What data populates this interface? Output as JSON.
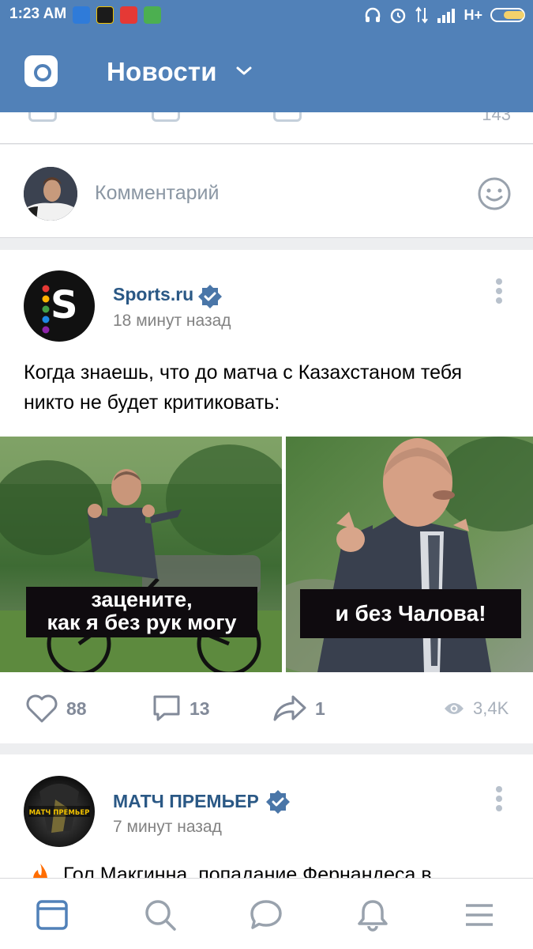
{
  "status_bar": {
    "time": "1:23 AM",
    "network": "H+",
    "colors": {
      "notif1": "#2f7bd9",
      "notif2": "#1b1b1b",
      "notif3": "#e53935",
      "notif4": "#4caf50"
    }
  },
  "header": {
    "title": "Новости",
    "icons": {
      "camera": "camera-icon",
      "dropdown": "chevron-down-icon"
    }
  },
  "prev_post": {
    "views": "143"
  },
  "comment": {
    "placeholder": "Комментарий"
  },
  "post": {
    "author": "Sports.ru",
    "time": "18 минут назад",
    "text": "Когда знаешь, что до матча с Казахстаном тебя никто не будет критиковать:",
    "photo_left_caption_line1": "зацените,",
    "photo_left_caption_line2": "как я без рук могу",
    "photo_right_caption": "и без Чалова!",
    "likes": "88",
    "comments": "13",
    "shares": "1",
    "views": "3,4K"
  },
  "post2": {
    "author": "МАТЧ ПРЕМЬЕР",
    "time": "7 минут назад",
    "text": "Гол Макгинна, попадание Фернандеса в",
    "avatar_logo": "МАТЧ ПРЕМЬЕР"
  },
  "bottom_nav": {
    "items": [
      "news-icon",
      "search-icon",
      "messages-icon",
      "notifications-icon",
      "menu-icon"
    ],
    "active_color": "#5181b8",
    "inactive_color": "#99a2ad"
  },
  "colors": {
    "brand": "#5181b8",
    "link": "#2a5885",
    "verified": "#4a76a8"
  }
}
